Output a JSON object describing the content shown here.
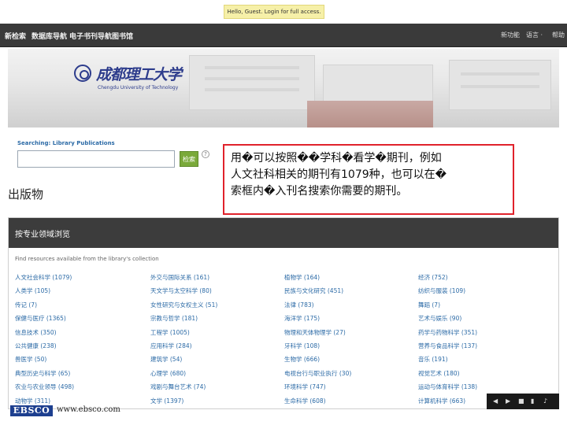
{
  "topbar": {
    "guest_text": "Hello, Guest. Login for full access."
  },
  "nav": {
    "left": [
      "新检索",
      "数据库导航",
      "电子书刊导航",
      "图书馆"
    ],
    "right": [
      "新功能",
      "语言 ·",
      "帮助"
    ]
  },
  "banner": {
    "logo_cn": "成都理工大学",
    "logo_en": "Chengdu University of Technology"
  },
  "search": {
    "label": "Searching: Library Publications",
    "input_value": "",
    "button_label": "检索",
    "help": "?"
  },
  "page_title": "出版物",
  "callout": {
    "lines": [
      "用�可以按照��学科�看学�期刊，例如",
      "人文社科相关的期刊有1079种，也可以在�",
      "索框内�入刊名搜索你需要的期刊。"
    ]
  },
  "browse": {
    "title": "按专业领域浏览",
    "description": "Find resources available from the library's collection",
    "columns": [
      [
        "人文社会科学 (1079)",
        "人类学 (105)",
        "传记 (7)",
        "保健与医疗 (1365)",
        "信息技术 (350)",
        "公共健康 (238)",
        "兽医学 (50)",
        "典型历史与科学 (65)",
        "农业与农业领导 (498)",
        "动物学 (311)"
      ],
      [
        "外交与国际关系 (161)",
        "天文学与太空科学 (80)",
        "女性研究与女权主义 (51)",
        "宗教与哲学 (181)",
        "工程学 (1005)",
        "应用科学 (284)",
        "建筑学 (54)",
        "心理学 (680)",
        "戏剧与舞台艺术 (74)",
        "文学 (1397)"
      ],
      [
        "植物学 (164)",
        "民族与文化研究 (451)",
        "法律 (783)",
        "海洋学 (175)",
        "物理和天体物理学 (27)",
        "牙科学 (108)",
        "生物学 (666)",
        "电视台行与职业执行 (30)",
        "环境科学 (747)",
        "生命科学 (608)"
      ],
      [
        "经济 (752)",
        "纺织与服装 (109)",
        "舞蹈 (7)",
        "艺术与娱乐 (90)",
        "药学与药物科学 (351)",
        "营养与食品科学 (137)",
        "音乐 (191)",
        "视觉艺术 (180)",
        "运动与体育科学 (138)",
        "计算机科学 (663)"
      ]
    ]
  },
  "footer": {
    "brand": "EBSCO",
    "url": "www.ebsco.com"
  },
  "media": {
    "icons": [
      "◀",
      "▶",
      "■",
      "▮",
      "♪"
    ]
  }
}
